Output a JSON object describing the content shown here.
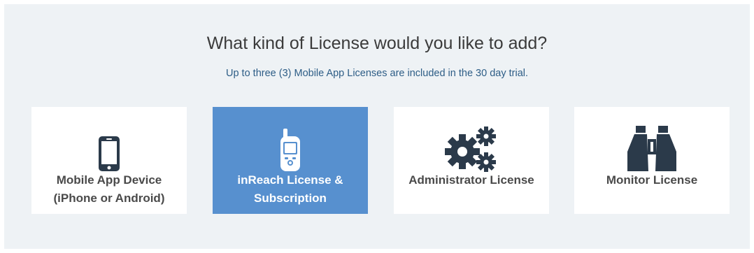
{
  "heading": {
    "title": "What kind of License would you like to add?",
    "subtitle": "Up to three (3) Mobile App Licenses are included in the 30 day trial."
  },
  "cards": [
    {
      "label_line1": "Mobile App Device",
      "label_line2": "(iPhone or Android)",
      "icon": "smartphone-icon",
      "selected": false
    },
    {
      "label_line1": "inReach License &",
      "label_line2": "Subscription",
      "icon": "inreach-device-icon",
      "selected": true
    },
    {
      "label_line1": "Administrator License",
      "label_line2": "",
      "icon": "gears-icon",
      "selected": false
    },
    {
      "label_line1": "Monitor License",
      "label_line2": "",
      "icon": "binoculars-icon",
      "selected": false
    }
  ],
  "colors": {
    "panel_background": "#eef2f5",
    "card_background": "#ffffff",
    "selected_card_background": "#5790cf",
    "icon_color": "#2b3a4a",
    "subtitle_color": "#2d5d86"
  }
}
